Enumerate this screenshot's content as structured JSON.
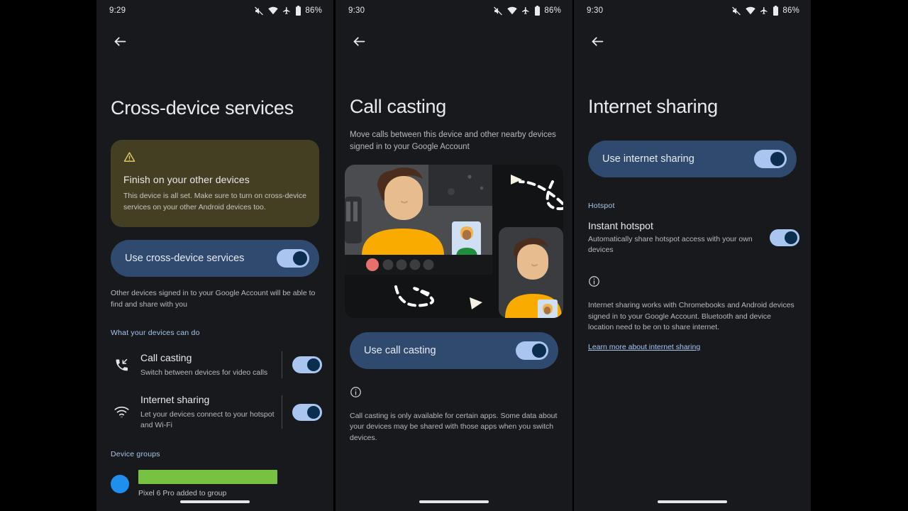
{
  "colors": {
    "screen_bg": "#17191c",
    "accent_blue": "#a8c7f0",
    "pill_bg": "#2f4a6e",
    "switch_track": "#aac6f0",
    "switch_knob": "#0b2e4f",
    "warning_card_bg": "#443f22",
    "warning_icon": "#e8d16a",
    "redaction_green": "#77c341",
    "avatar_blue": "#1f8fef"
  },
  "phones": [
    {
      "status": {
        "time": "9:29",
        "battery": "86%",
        "icons": [
          "vibrate-muted-icon",
          "wifi-icon",
          "airplane-mode-icon",
          "battery-icon"
        ]
      },
      "back_label": "back-arrow",
      "title": "Cross-device services",
      "warning": {
        "icon": "warning-triangle-icon",
        "title": "Finish on your other devices",
        "body": "This device is all set. Make sure to turn on cross-device services on your other Android devices too."
      },
      "main_toggle": {
        "label": "Use cross-device services",
        "state": "on"
      },
      "helper": "Other devices signed in to your Google Account will be able to find and share with you",
      "section_label": "What your devices can do",
      "capabilities": [
        {
          "icon": "call-casting-icon",
          "title": "Call casting",
          "subtitle": "Switch between devices for video calls",
          "state": "on"
        },
        {
          "icon": "wifi-icon",
          "title": "Internet sharing",
          "subtitle": "Let your devices connect to your hotspot and Wi-Fi",
          "state": "on"
        }
      ],
      "groups_label": "Device groups",
      "group": {
        "name_redacted": true,
        "subtitle": "Pixel 6 Pro added to group"
      }
    },
    {
      "status": {
        "time": "9:30",
        "battery": "86%",
        "icons": [
          "vibrate-muted-icon",
          "wifi-icon",
          "airplane-mode-icon",
          "battery-icon"
        ]
      },
      "back_label": "back-arrow",
      "title": "Call casting",
      "subtitle": "Move calls between this device and other nearby devices signed in to your Google Account",
      "illustration": "video-call-handoff-illustration",
      "main_toggle": {
        "label": "Use call casting",
        "state": "on"
      },
      "info_icon": "info-circle-icon",
      "info_text": "Call casting is only available for certain apps. Some data about your devices may be shared with those apps when you switch devices."
    },
    {
      "status": {
        "time": "9:30",
        "battery": "86%",
        "icons": [
          "vibrate-muted-icon",
          "wifi-icon",
          "airplane-mode-icon",
          "battery-icon"
        ]
      },
      "back_label": "back-arrow",
      "title": "Internet sharing",
      "main_toggle": {
        "label": "Use internet sharing",
        "state": "on"
      },
      "section_label": "Hotspot",
      "hotspot": {
        "title": "Instant hotspot",
        "subtitle": "Automatically share hotspot access with your own devices",
        "state": "on"
      },
      "info_icon": "info-circle-icon",
      "info_text": "Internet sharing works with Chromebooks and Android devices signed in to your Google Account. Bluetooth and device location need to be on to share internet.",
      "link_text": "Learn more about internet sharing"
    }
  ]
}
